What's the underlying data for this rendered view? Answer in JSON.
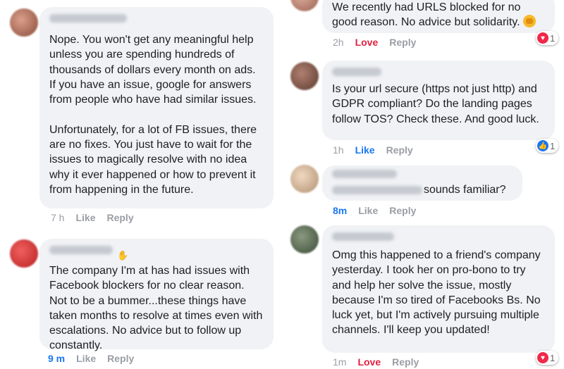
{
  "comments": [
    {
      "text": "Nope. You won't get any meaningful help unless you are spending hundreds of thousands of dollars every month on ads. If you have an issue, google for answers from people who have had similar issues.\n\nUnfortunately, for a lot of FB issues, there are no fixes. You just have to wait for the issues to magically resolve with no idea why it ever happened or how to prevent it from happening in the future.",
      "time": "7 h",
      "like": "Like",
      "reply": "Reply"
    },
    {
      "text": "The company I'm at has had issues with Facebook blockers for no clear reason. Not to be a bummer...these things have taken months to resolve at times even with escalations. No advice but to follow up constantly.",
      "time": "9 m",
      "like": "Like",
      "reply": "Reply"
    },
    {
      "text": "We recently had URLS blocked for no good reason. No advice but solidarity.",
      "emoji": "raised-fist-emoji",
      "time": "2h",
      "like": "Love",
      "reply": "Reply",
      "reaction": {
        "type": "love",
        "count": "1"
      }
    },
    {
      "text": "Is your url secure (https not just http) and GDPR compliant? Do the landing pages follow TOS? Check these. And good luck.",
      "time": "1h",
      "like": "Like",
      "reply": "Reply",
      "reaction": {
        "type": "like",
        "count": "1"
      }
    },
    {
      "text": "sounds familiar?",
      "time": "8m",
      "like": "Like",
      "reply": "Reply"
    },
    {
      "text": "Omg this happened to a friend's company yesterday. I took her on pro-bono to try and help her solve the issue, mostly because I'm so tired of Facebooks Bs. No luck yet, but I'm actively pursuing multiple channels. I'll keep you updated!",
      "time": "1m",
      "like": "Love",
      "reply": "Reply",
      "reaction": {
        "type": "love",
        "count": "1"
      }
    }
  ],
  "colors": {
    "bubble": "#f0f2f5",
    "love": "#e41e3f",
    "like": "#1877f2",
    "meta": "#9a9ea4"
  }
}
